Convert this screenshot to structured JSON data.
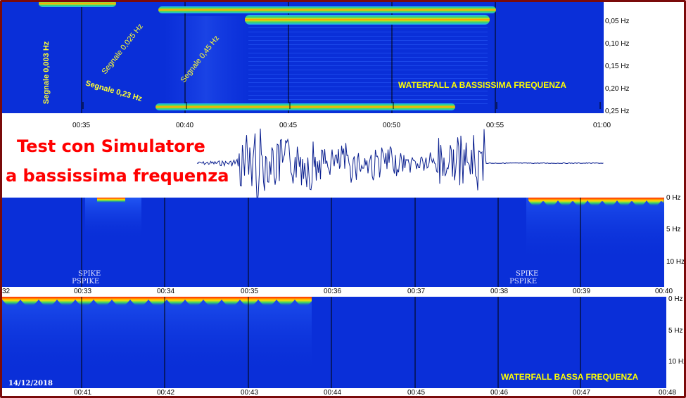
{
  "top_panel": {
    "title": "WATERFALL A BASSISSIMA FREQUENZA",
    "freq_ticks": [
      "0,05 Hz",
      "0,10 Hz",
      "0,15 Hz",
      "0,20 Hz",
      "0,25 Hz"
    ],
    "time_ticks": [
      "00:35",
      "00:40",
      "00:45",
      "00:50",
      "00:55",
      "01:00"
    ],
    "annotations": [
      "Segnale 0,003 Hz",
      "Segnale 0,025 Hz",
      "Segnale 0,45 Hz",
      "Segnale 0,23 Hz"
    ]
  },
  "headline": {
    "line1": "Test con Simulatore",
    "line2": "a bassissima frequenza"
  },
  "middle_panel": {
    "freq_ticks": [
      "0 Hz",
      "5 Hz",
      "10 Hz"
    ],
    "time_ticks": [
      "32",
      "00:33",
      "00:34",
      "00:35",
      "00:36",
      "00:37",
      "00:38",
      "00:39",
      "00:40"
    ],
    "spike_labels": [
      {
        "line1": "SPIKE",
        "line2": "PSPIKE"
      },
      {
        "line1": "SPIKE",
        "line2": "PSPIKE"
      }
    ]
  },
  "bottom_panel": {
    "title": "WATERFALL BASSA FREQUENZA",
    "date": "14/12/2018",
    "freq_ticks": [
      "0 Hz",
      "5 Hz",
      "10 Hz"
    ],
    "time_ticks": [
      "00:41",
      "00:42",
      "00:43",
      "00:44",
      "00:45",
      "00:46",
      "00:47",
      "00:48"
    ]
  },
  "colors": {
    "waterfall_bg": "#0a2fd8",
    "hot": "#ff2a00",
    "warm": "#ffd000",
    "mid": "#26c76a",
    "border": "#7a0a0a",
    "trace": "#0a1f8f",
    "annotation": "#ffff33",
    "headline": "#ff0000"
  }
}
